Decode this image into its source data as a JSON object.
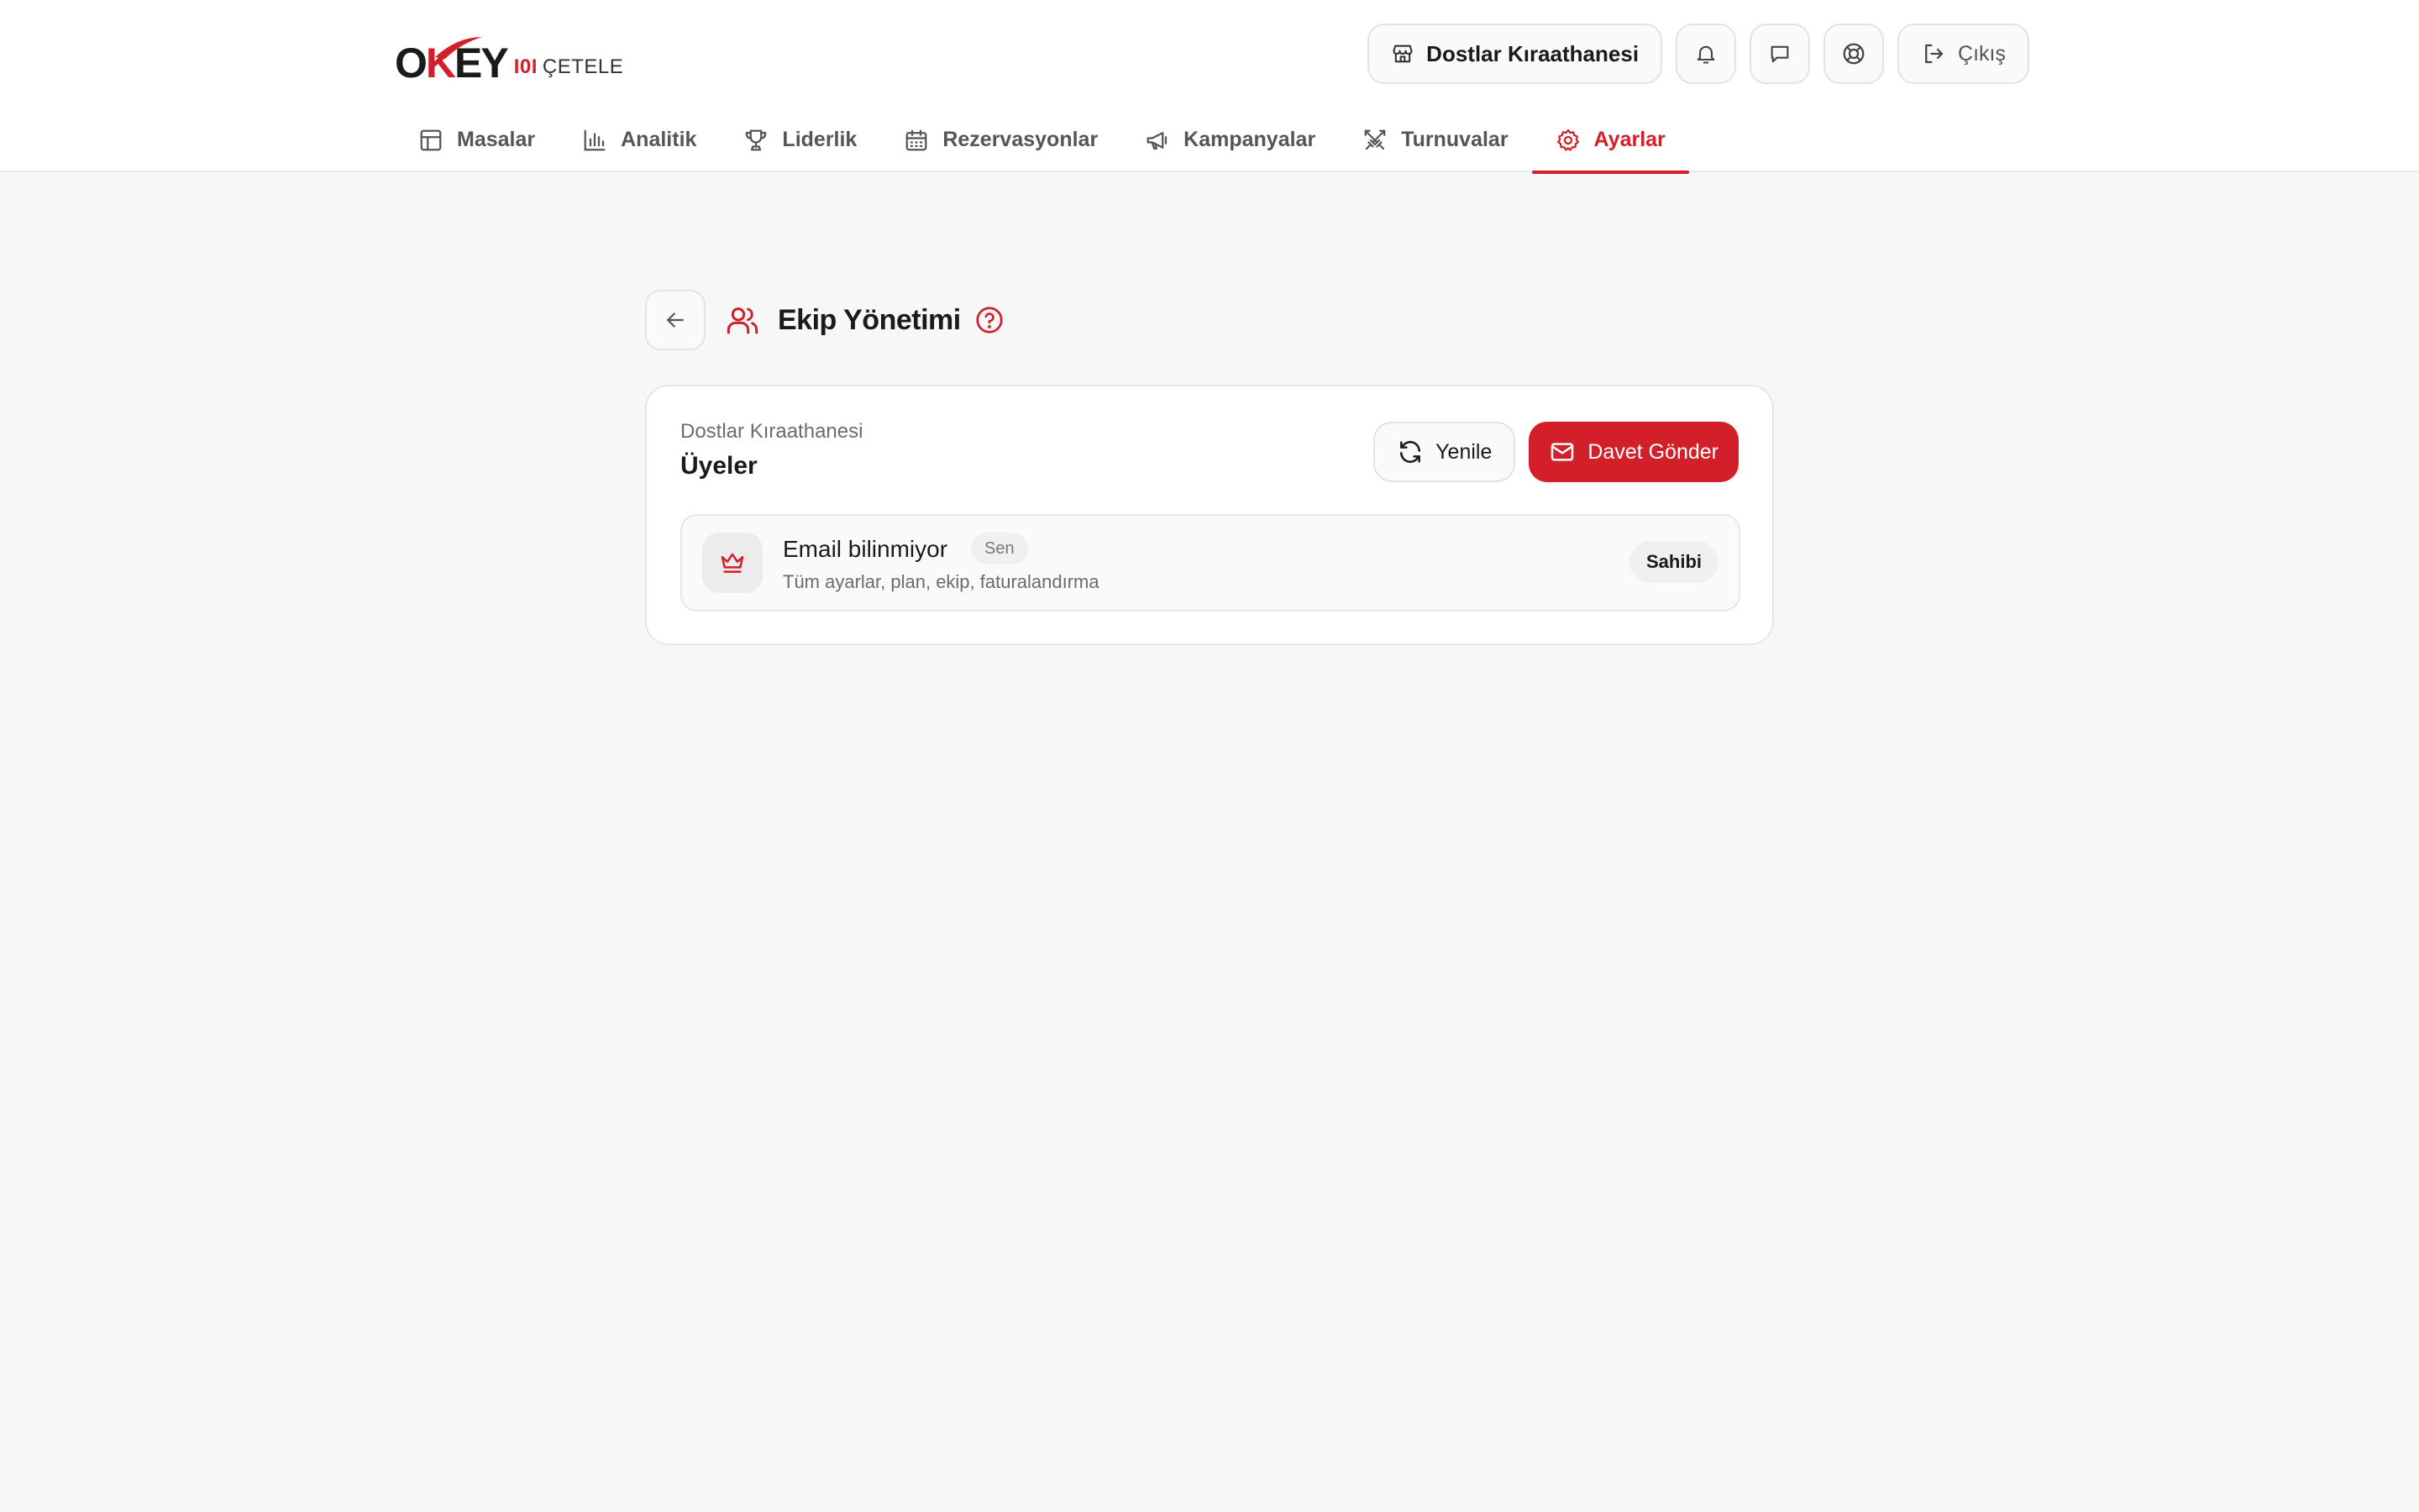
{
  "brand": {
    "logo_main_o": "O",
    "logo_main_k": "K",
    "logo_main_rest": "EY",
    "logo_io": "I0I",
    "logo_sub": "ÇETELE"
  },
  "header": {
    "venue_name": "Dostlar Kıraathanesi",
    "logout_label": "Çıkış"
  },
  "nav": {
    "items": [
      {
        "label": "Masalar",
        "icon": "table-icon"
      },
      {
        "label": "Analitik",
        "icon": "bar-chart-icon"
      },
      {
        "label": "Liderlik",
        "icon": "trophy-icon"
      },
      {
        "label": "Rezervasyonlar",
        "icon": "calendar-icon"
      },
      {
        "label": "Kampanyalar",
        "icon": "megaphone-icon"
      },
      {
        "label": "Turnuvalar",
        "icon": "swords-icon"
      },
      {
        "label": "Ayarlar",
        "icon": "settings-icon",
        "active": true
      }
    ]
  },
  "page": {
    "title": "Ekip Yönetimi"
  },
  "members_card": {
    "venue": "Dostlar Kıraathanesi",
    "title": "Üyeler",
    "refresh_label": "Yenile",
    "invite_label": "Davet Gönder",
    "members": [
      {
        "name": "Email bilinmiyor",
        "you_badge": "Sen",
        "permissions": "Tüm ayarlar, plan, ekip, faturalandırma",
        "role": "Sahibi"
      }
    ]
  },
  "colors": {
    "accent": "#d21f2a",
    "background": "#f7f7f7",
    "surface": "#ffffff"
  }
}
